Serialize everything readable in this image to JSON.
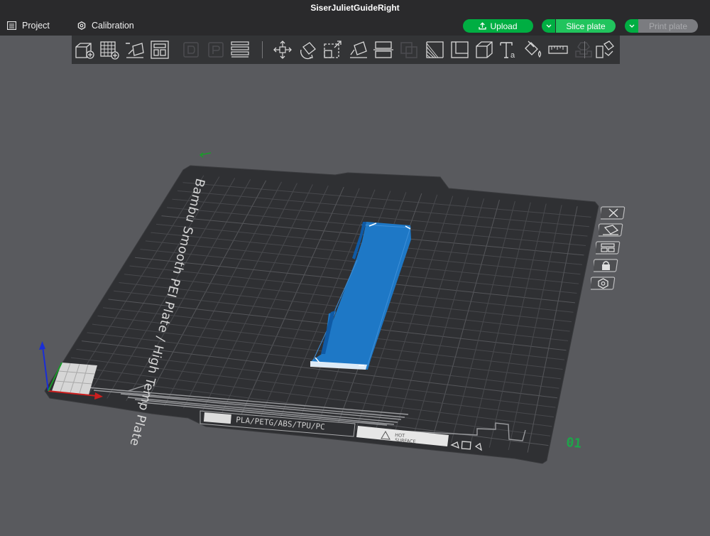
{
  "window": {
    "title": "SiserJulietGuideRight"
  },
  "menu": {
    "project_label": "Project",
    "calibration_label": "Calibration"
  },
  "actions": {
    "upload_label": "Upload",
    "slice_label": "Slice plate",
    "print_label": "Print plate"
  },
  "colors": {
    "accent": "#00ae42",
    "model": "#1a78c8",
    "background": "#595a5e",
    "bed": "#2f3033"
  },
  "toolbar": {
    "icons": [
      "add-object-icon",
      "add-plate-icon",
      "auto-orient-icon",
      "arrange-icon",
      "split-objects-icon",
      "split-parts-icon",
      "layers-icon",
      "move-icon",
      "rotate-icon",
      "scale-icon",
      "lay-on-face-icon",
      "cut-icon",
      "boolean-icon",
      "support-paint-icon",
      "seam-paint-icon",
      "variable-layer-icon",
      "text-icon",
      "color-paint-icon",
      "measure-icon",
      "assembly-icon",
      "assembly-view-icon"
    ]
  },
  "bed": {
    "brand_text": "Bambu Smooth PEI Plate / High Temp Plate",
    "materials_text": "PLA/PETG/ABS/TPU/PC",
    "warning_text_1": "HOT",
    "warning_text_2": "SURFACE",
    "plate_number": "01"
  },
  "side_controls": [
    "close-plate-icon",
    "orient-plate-icon",
    "arrange-plate-icon",
    "lock-plate-icon",
    "plate-settings-icon"
  ]
}
